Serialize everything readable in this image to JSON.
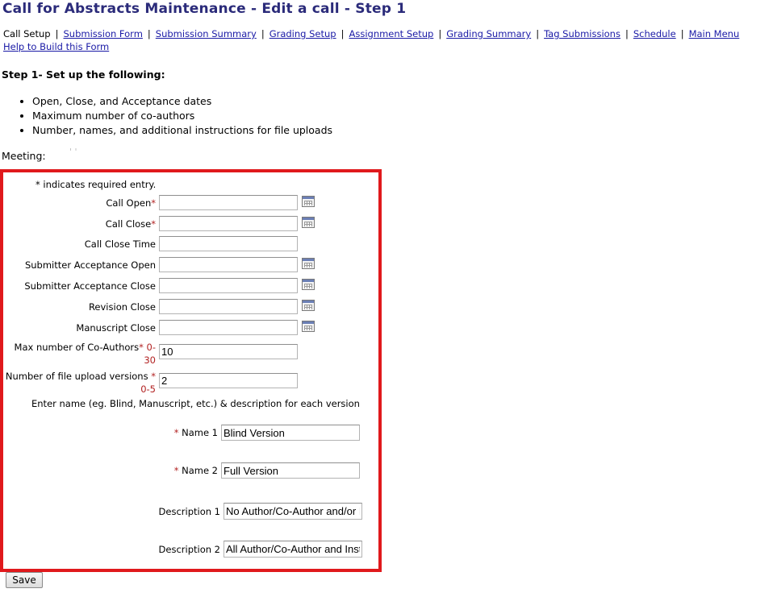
{
  "page": {
    "title": "Call for Abstracts Maintenance - Edit a call - Step 1"
  },
  "nav": {
    "current": "Call Setup",
    "links": [
      "Submission Form",
      "Submission Summary",
      "Grading Setup",
      "Assignment Setup",
      "Grading Summary",
      "Tag Submissions",
      "Schedule",
      "Main Menu"
    ],
    "help": "Help to Build this Form"
  },
  "intro": {
    "heading": "Step 1- Set up the following:",
    "points": [
      "Open, Close, and Acceptance dates",
      "Maximum number of co-authors",
      "Number, names, and additional instructions for file uploads"
    ]
  },
  "meeting": {
    "label": "Meeting:",
    "value": "' '"
  },
  "form": {
    "required_note": "* indicates required entry.",
    "call_open": {
      "label": "Call Open",
      "required": "*",
      "value": ""
    },
    "call_close": {
      "label": "Call Close",
      "required": "*",
      "value": ""
    },
    "call_close_time": {
      "label": "Call Close Time",
      "value": ""
    },
    "submitter_acceptance_open": {
      "label": "Submitter Acceptance Open",
      "value": ""
    },
    "submitter_acceptance_close": {
      "label": "Submitter Acceptance Close",
      "value": ""
    },
    "revision_close": {
      "label": "Revision Close",
      "value": ""
    },
    "manuscript_close": {
      "label": "Manuscript Close",
      "value": ""
    },
    "max_coauthors": {
      "label": "Max number of Co-Authors",
      "required": "*",
      "range": "0-30",
      "value": "10"
    },
    "file_versions": {
      "label": "Number of file upload versions",
      "required": "*",
      "range": "0-5",
      "value": "2"
    },
    "version_instructions": "Enter name (eg. Blind, Manuscript, etc.) & description for each version",
    "name1": {
      "label": "Name 1",
      "required": "*",
      "value": "Blind Version"
    },
    "name2": {
      "label": "Name 2",
      "required": "*",
      "value": "Full Version"
    },
    "desc1": {
      "label": "Description 1",
      "value": "No Author/Co-Author and/or I"
    },
    "desc2": {
      "label": "Description 2",
      "value": "All Author/Co-Author and Inst"
    }
  },
  "actions": {
    "save": "Save"
  },
  "colors": {
    "title": "#2b2b7a",
    "link": "#1a1aa6",
    "highlight_border": "#e0191c",
    "required": "#b22222"
  }
}
